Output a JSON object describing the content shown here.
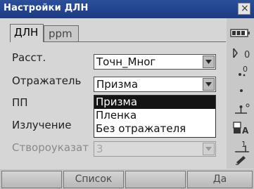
{
  "window": {
    "title": "Настройки ДЛН",
    "close_glyph": "×"
  },
  "tabs": [
    {
      "label": "ДЛН",
      "active": true
    },
    {
      "label": "ppm",
      "active": false
    }
  ],
  "form": {
    "rasst": {
      "label": "Расст.",
      "value": "Точн_Мног"
    },
    "otrazhatel": {
      "label": "Отражатель",
      "value": "Призма"
    },
    "pp": {
      "label": "ПП"
    },
    "izluchenie": {
      "label": "Излучение"
    },
    "stvoroukazat": {
      "label": "Створоуказат",
      "value": "3",
      "disabled": true
    }
  },
  "dropdown": {
    "options": [
      "Призма",
      "Пленка",
      "Без отражателя"
    ],
    "selected_index": 0
  },
  "sidebar": {
    "icons": [
      {
        "name": "battery-icon",
        "text": ""
      },
      {
        "name": "target-mode-icon",
        "text": "0"
      },
      {
        "name": "prism-constant-icon",
        "text": "0"
      },
      {
        "name": "dot-icon",
        "text": ""
      },
      {
        "name": "level-icon",
        "text": ""
      },
      {
        "name": "keyboard-mode-icon",
        "text": "A"
      },
      {
        "name": "page-number-icon",
        "text": "1"
      },
      {
        "name": "pen-icon",
        "text": ""
      }
    ]
  },
  "softkeys": [
    {
      "label": ""
    },
    {
      "label": "Список"
    },
    {
      "label": ""
    },
    {
      "label": "Да"
    }
  ],
  "colors": {
    "titlebar": "#1c3c83",
    "window_bg": "#d6d6d6",
    "selection": "#141414"
  }
}
